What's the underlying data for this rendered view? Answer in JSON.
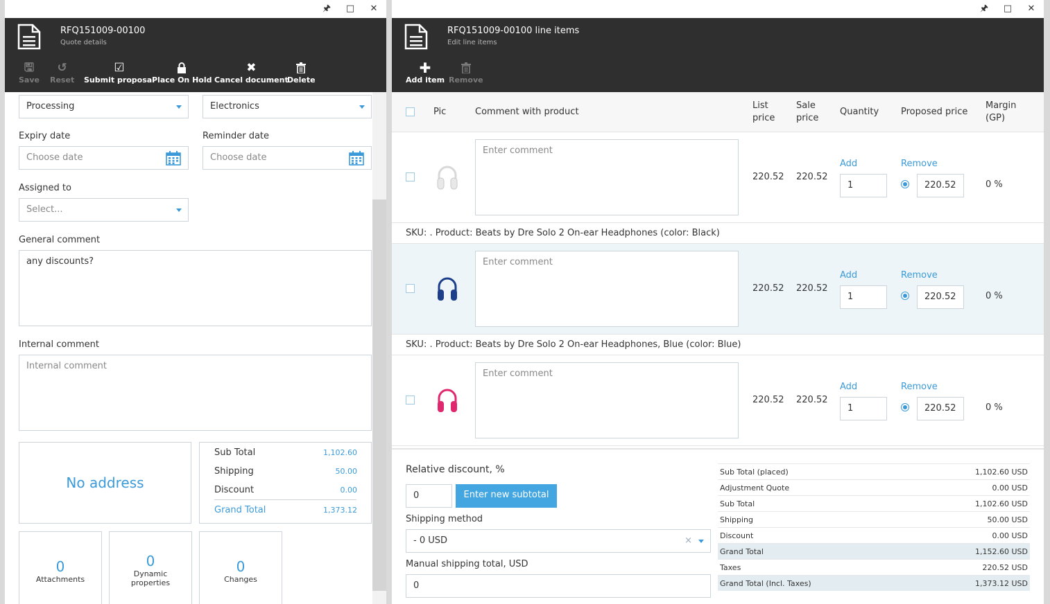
{
  "left": {
    "title": "RFQ151009-00100",
    "subtitle": "Quote details",
    "toolbar": {
      "save": "Save",
      "reset": "Reset",
      "submit": "Submit proposal",
      "hold": "Place On Hold",
      "cancel": "Cancel document",
      "delete": "Delete"
    },
    "status_value": "Processing",
    "category_value": "Electronics",
    "expiry_label": "Expiry date",
    "expiry_placeholder": "Choose date",
    "reminder_label": "Reminder date",
    "reminder_placeholder": "Choose date",
    "assigned_label": "Assigned to",
    "assigned_placeholder": "Select...",
    "general_comment_label": "General comment",
    "general_comment_value": "any discounts?",
    "internal_comment_label": "Internal comment",
    "internal_comment_placeholder": "Internal comment",
    "no_address": "No address",
    "summary": {
      "subtotal_label": "Sub Total",
      "subtotal": "1,102.60",
      "shipping_label": "Shipping",
      "shipping": "50.00",
      "discount_label": "Discount",
      "discount": "0.00",
      "grand_label": "Grand Total",
      "grand": "1,373.12"
    },
    "tiles": {
      "attachments_count": "0",
      "attachments_label": "Attachments",
      "dynamic_count": "0",
      "dynamic_label_1": "Dynamic",
      "dynamic_label_2": "properties",
      "changes_count": "0",
      "changes_label": "Changes"
    }
  },
  "right": {
    "title": "RFQ151009-00100 line items",
    "subtitle": "Edit line items",
    "toolbar": {
      "add": "Add item",
      "remove": "Remove"
    },
    "columns": {
      "pic": "Pic",
      "comment": "Comment with product",
      "list_1": "List",
      "list_2": "price",
      "sale_1": "Sale",
      "sale_2": "price",
      "quantity": "Quantity",
      "proposed": "Proposed price",
      "margin_1": "Margin",
      "margin_2": "(GP)"
    },
    "items": [
      {
        "comment_placeholder": "Enter comment",
        "list_price": "220.52",
        "sale_price": "220.52",
        "add": "Add",
        "qty": "1",
        "remove": "Remove",
        "proposed": "220.52",
        "margin": "0 %",
        "sku": "SKU: . Product: Beats by Dre Solo 2 On-ear Headphones (color: Black)",
        "color": "#e8e8e8"
      },
      {
        "comment_placeholder": "Enter comment",
        "list_price": "220.52",
        "sale_price": "220.52",
        "add": "Add",
        "qty": "1",
        "remove": "Remove",
        "proposed": "220.52",
        "margin": "0 %",
        "sku": "SKU: . Product: Beats by Dre Solo 2 On-ear Headphones, Blue (color: Blue)",
        "color": "#1d3f8a"
      },
      {
        "comment_placeholder": "Enter comment",
        "list_price": "220.52",
        "sale_price": "220.52",
        "add": "Add",
        "qty": "1",
        "remove": "Remove",
        "proposed": "220.52",
        "margin": "0 %",
        "color": "#e0286e"
      }
    ],
    "footer": {
      "relative_discount_label": "Relative discount, %",
      "relative_discount_value": "0",
      "enter_subtotal": "Enter new subtotal",
      "shipping_method_label": "Shipping method",
      "shipping_method_value": "- 0 USD",
      "manual_shipping_label": "Manual shipping total, USD",
      "manual_shipping_value": "0"
    },
    "totals": [
      {
        "label": "Sub Total (placed)",
        "value": "1,102.60 USD"
      },
      {
        "label": "Adjustment Quote",
        "value": "0.00 USD"
      },
      {
        "label": "Sub Total",
        "value": "1,102.60 USD"
      },
      {
        "label": "Shipping",
        "value": "50.00 USD"
      },
      {
        "label": "Discount",
        "value": "0.00 USD"
      },
      {
        "label": "Grand Total",
        "value": "1,152.60 USD"
      },
      {
        "label": "Taxes",
        "value": "220.52 USD"
      },
      {
        "label": "Grand Total (Incl. Taxes)",
        "value": "1,373.12 USD"
      }
    ]
  },
  "colors": {
    "accent": "#3a9ad9",
    "header_bg": "#2f2f2f",
    "button_blue": "#43a6e0"
  },
  "icons": [
    "document-icon",
    "pin-icon",
    "maximize-icon",
    "close-icon",
    "save-icon",
    "reset-icon",
    "check-icon",
    "lock-icon",
    "x-icon",
    "trash-icon",
    "plus-icon",
    "calendar-icon",
    "headphones-icon"
  ]
}
